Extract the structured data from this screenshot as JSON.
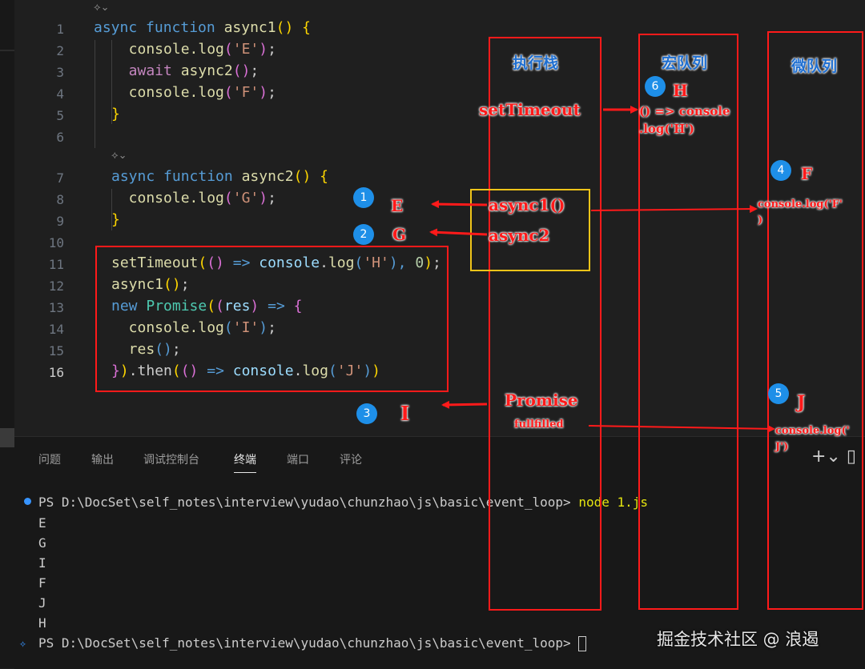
{
  "editor": {
    "codelens": "⟡⌄",
    "line_numbers": [
      "1",
      "2",
      "3",
      "4",
      "5",
      "6",
      "7",
      "8",
      "9",
      "10",
      "11",
      "12",
      "13",
      "14",
      "15",
      "16"
    ],
    "active_line": "16",
    "lines": {
      "l1": [
        [
          "k",
          "async "
        ],
        [
          "k",
          "function "
        ],
        [
          "f",
          "async1"
        ],
        [
          "p",
          "() {"
        ]
      ],
      "l2": [
        [
          "f",
          "  console."
        ],
        [
          "f",
          "log"
        ],
        [
          "pp",
          "("
        ],
        [
          "s",
          "'E'"
        ],
        [
          "pp",
          ")"
        ],
        [
          "",
          "; "
        ]
      ],
      "l3": [
        [
          "kw",
          "  await "
        ],
        [
          "f",
          "async2"
        ],
        [
          "pp",
          "()"
        ],
        [
          "",
          ";"
        ]
      ],
      "l4": [
        [
          "f",
          "  console."
        ],
        [
          "f",
          "log"
        ],
        [
          "pp",
          "("
        ],
        [
          "s",
          "'F'"
        ],
        [
          "pp",
          ")"
        ],
        [
          "",
          ";"
        ]
      ],
      "l5": [
        [
          "p",
          "}"
        ]
      ],
      "l7": [
        [
          "k",
          "async "
        ],
        [
          "k",
          "function "
        ],
        [
          "f",
          "async2"
        ],
        [
          "p",
          "() {"
        ]
      ],
      "l8": [
        [
          "f",
          "  console."
        ],
        [
          "f",
          "log"
        ],
        [
          "pp",
          "("
        ],
        [
          "s",
          "'G'"
        ],
        [
          "pp",
          ")"
        ],
        [
          "",
          ";"
        ]
      ],
      "l9": [
        [
          "p",
          "}"
        ]
      ],
      "l11": [
        [
          "f",
          "setTimeout"
        ],
        [
          "p",
          "("
        ],
        [
          "pp",
          "() "
        ],
        [
          "k",
          "=> "
        ],
        [
          "v",
          "console"
        ],
        [
          "",
          "."
        ],
        [
          "f",
          "log"
        ],
        [
          "k",
          "("
        ],
        [
          "s",
          "'H'"
        ],
        [
          "k",
          "), "
        ],
        [
          "n",
          "0"
        ],
        [
          "p",
          ")"
        ],
        [
          "",
          ";"
        ]
      ],
      "l12": [
        [
          "f",
          "async1"
        ],
        [
          "p",
          "()"
        ],
        [
          "",
          ";"
        ]
      ],
      "l13": [
        [
          "k",
          "new "
        ],
        [
          "c",
          "Promise"
        ],
        [
          "p",
          "("
        ],
        [
          "pp",
          "("
        ],
        [
          "v",
          "res"
        ],
        [
          "pp",
          ") "
        ],
        [
          "k",
          "=> "
        ],
        [
          "pp",
          "{"
        ]
      ],
      "l14": [
        [
          "f",
          "  console."
        ],
        [
          "f",
          "log"
        ],
        [
          "k",
          "("
        ],
        [
          "s",
          "'I'"
        ],
        [
          "k",
          ")"
        ],
        [
          "",
          ";"
        ]
      ],
      "l15": [
        [
          "f",
          "  res"
        ],
        [
          "k",
          "()"
        ],
        [
          "",
          ";"
        ]
      ],
      "l16": [
        [
          "pp",
          "}"
        ],
        [
          "p",
          ")"
        ],
        [
          "",
          ".then"
        ],
        [
          "p",
          "("
        ],
        [
          "pp",
          "() "
        ],
        [
          "k",
          "=> "
        ],
        [
          "v",
          "console"
        ],
        [
          "",
          "."
        ],
        [
          "f",
          "log"
        ],
        [
          "k",
          "("
        ],
        [
          "s",
          "'J'"
        ],
        [
          "k",
          ")"
        ],
        [
          "p",
          ")"
        ]
      ]
    }
  },
  "panel": {
    "tabs": [
      "问题",
      "输出",
      "调试控制台",
      "终端",
      "端口",
      "评论"
    ],
    "active_tab": "终端",
    "actions": "+⌄ ▯"
  },
  "terminal": {
    "command_line": "PS D:\\DocSet\\self_notes\\interview\\yudao\\chunzhao\\js\\basic\\event_loop> node 1.js",
    "prompt_path": "PS D:\\DocSet\\self_notes\\interview\\yudao\\chunzhao\\js\\basic\\event_loop>",
    "command": "node 1.js",
    "output": [
      "E",
      "G",
      "I",
      "F",
      "J",
      "H"
    ],
    "prompt_line": "PS D:\\DocSet\\self_notes\\interview\\yudao\\chunzhao\\js\\basic\\event_loop>"
  },
  "annotations": {
    "exec_stack_title": "执行栈",
    "macro_queue_title": "宏队列",
    "micro_queue_title": "微队列",
    "set_timeout": "setTimeout",
    "macro_item": "() => console\n.log('H')",
    "async1_call": "async1()",
    "async2_call": "async2",
    "promise": "Promise",
    "fullfilled": "fullfilled",
    "micro_f": "console.log('F'\n)",
    "micro_j": "console.log('\nJ')",
    "letters": {
      "E": "E",
      "G": "G",
      "I": "I",
      "F": "F",
      "J": "J",
      "H": "H"
    },
    "badges": [
      "1",
      "2",
      "3",
      "4",
      "5",
      "6"
    ]
  },
  "colors": {
    "annotation_red": "#ff1a1a",
    "highlight_yellow": "#f0c419",
    "header_blue": "#1f6fd1",
    "badge_blue": "#1e8fe8"
  },
  "watermark": "掘金技术社区 @ 浪遏"
}
